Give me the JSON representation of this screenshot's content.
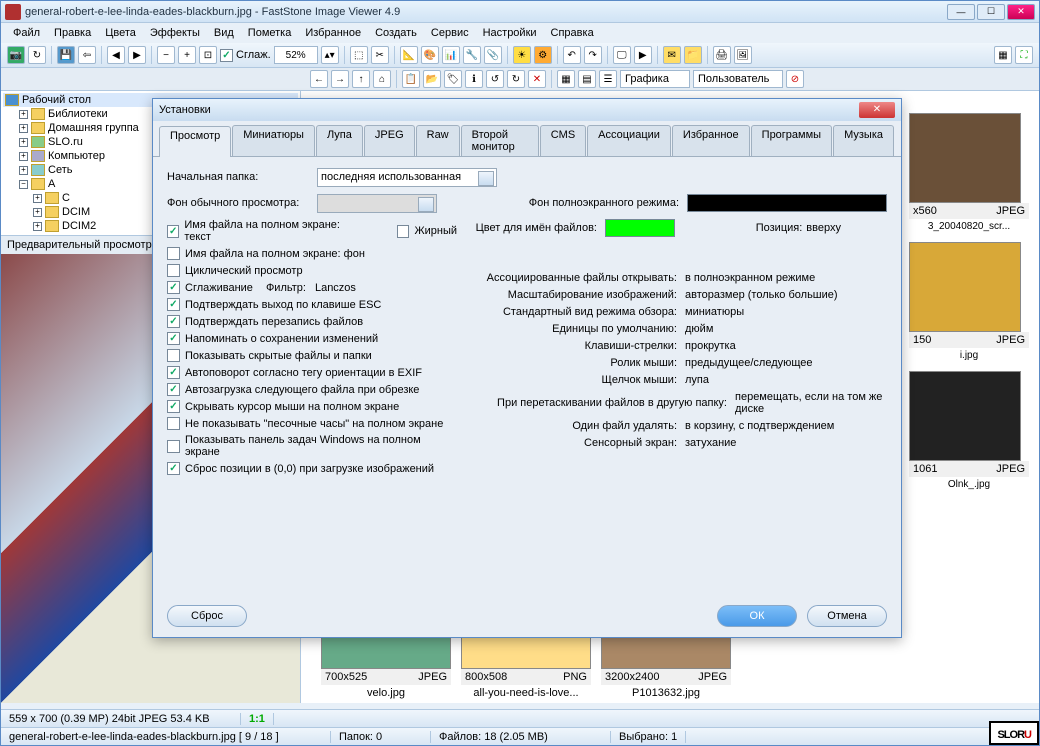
{
  "window": {
    "title": "general-robert-e-lee-linda-eades-blackburn.jpg  -  FastStone Image Viewer 4.9"
  },
  "menu": [
    "Файл",
    "Правка",
    "Цвета",
    "Эффекты",
    "Вид",
    "Пометка",
    "Избранное",
    "Создать",
    "Сервис",
    "Настройки",
    "Справка"
  ],
  "toolbar": {
    "smooth_label": "Сглаж.",
    "zoom": "52%"
  },
  "subbar": {
    "graphics": "Графика",
    "user": "Пользователь"
  },
  "tree": {
    "root": "Рабочий стол",
    "items": [
      "Библиотеки",
      "Домашняя группа",
      "SLO.ru",
      "Компьютер",
      "Сеть",
      "A",
      "C",
      "DCIM",
      "DCIM2"
    ]
  },
  "preview_header": "Предварительный просмотр",
  "dialog": {
    "title": "Установки",
    "tabs": [
      "Просмотр",
      "Миниатюры",
      "Лупа",
      "JPEG",
      "Raw",
      "Второй монитор",
      "CMS",
      "Ассоциации",
      "Избранное",
      "Программы",
      "Музыка"
    ],
    "start_folder_lbl": "Начальная папка:",
    "start_folder_val": "последняя использованная",
    "bg_normal_lbl": "Фон обычного просмотра:",
    "bg_full_lbl": "Фон полноэкранного режима:",
    "bg_full_color": "#000000",
    "name_color_lbl": "Цвет для имён файлов:",
    "name_color": "#00ff00",
    "pos_lbl": "Позиция:",
    "pos_val": "вверху",
    "bold_lbl": "Жирный",
    "checks": [
      {
        "on": true,
        "label": "Имя файла на полном экране: текст"
      },
      {
        "on": false,
        "label": "Имя файла на полном экране: фон"
      },
      {
        "on": false,
        "label": "Циклический просмотр"
      },
      {
        "on": true,
        "label": "Сглаживание"
      },
      {
        "on": true,
        "label": "Подтверждать выход по клавише ESC"
      },
      {
        "on": true,
        "label": "Подтверждать перезапись файлов"
      },
      {
        "on": true,
        "label": "Напоминать о сохранении изменений"
      },
      {
        "on": false,
        "label": "Показывать скрытые файлы и папки"
      },
      {
        "on": true,
        "label": "Автоповорот согласно тегу ориентации в EXIF"
      },
      {
        "on": true,
        "label": "Автозагрузка следующего файла при обрезке"
      },
      {
        "on": true,
        "label": "Скрывать курсор мыши на полном экране"
      },
      {
        "on": false,
        "label": "Не показывать \"песочные часы\" на полном экране"
      },
      {
        "on": false,
        "label": "Показывать панель задач Windows на полном экране"
      },
      {
        "on": true,
        "label": "Сброс позиции в (0,0) при загрузке изображений"
      }
    ],
    "filter_lbl": "Фильтр:",
    "filter_val": "Lanczos",
    "selects": [
      {
        "label": "Ассоциированные файлы открывать:",
        "value": "в полноэкранном режиме"
      },
      {
        "label": "Масштабирование изображений:",
        "value": "авторазмер (только большие)"
      },
      {
        "label": "Стандартный вид режима обзора:",
        "value": "миниатюры"
      },
      {
        "label": "Единицы по умолчанию:",
        "value": "дюйм"
      },
      {
        "label": "Клавиши-стрелки:",
        "value": "прокрутка"
      },
      {
        "label": "Ролик мыши:",
        "value": "предыдущее/следующее"
      },
      {
        "label": "Щелчок мыши:",
        "value": "лупа"
      },
      {
        "label": "При перетаскивании файлов в другую папку:",
        "value": "перемещать, если на том же диске"
      },
      {
        "label": "Один файл удалять:",
        "value": "в корзину, с подтверждением"
      },
      {
        "label": "Сенсорный экран:",
        "value": "затухание"
      }
    ],
    "reset": "Сброс",
    "ok": "ОК",
    "cancel": "Отмена"
  },
  "thumbs": [
    {
      "dims": "700x525",
      "fmt": "JPEG",
      "name": "velo.jpg"
    },
    {
      "dims": "800x508",
      "fmt": "PNG",
      "name": "all-you-need-is-love..."
    },
    {
      "dims": "3200x2400",
      "fmt": "JPEG",
      "name": "P1013632.jpg"
    }
  ],
  "right_thumbs": [
    {
      "dims": "x560",
      "fmt": "JPEG",
      "name": "3_20040820_scr..."
    },
    {
      "dims": "150",
      "fmt": "JPEG",
      "name": "i.jpg"
    },
    {
      "dims": "1061",
      "fmt": "JPEG",
      "name": "Olnk_.jpg"
    }
  ],
  "status1": {
    "info": "559 x 700 (0.39 MP)  24bit  JPEG  53.4 KB",
    "ratio": "1:1"
  },
  "status2": {
    "file": "general-robert-e-lee-linda-eades-blackburn.jpg [ 9 / 18 ]",
    "folders": "Папок: 0",
    "files": "Файлов: 18 (2.05 MB)",
    "selected": "Выбрано: 1"
  },
  "badge": {
    "s": "SLO",
    "r": "R",
    "u": "U"
  }
}
